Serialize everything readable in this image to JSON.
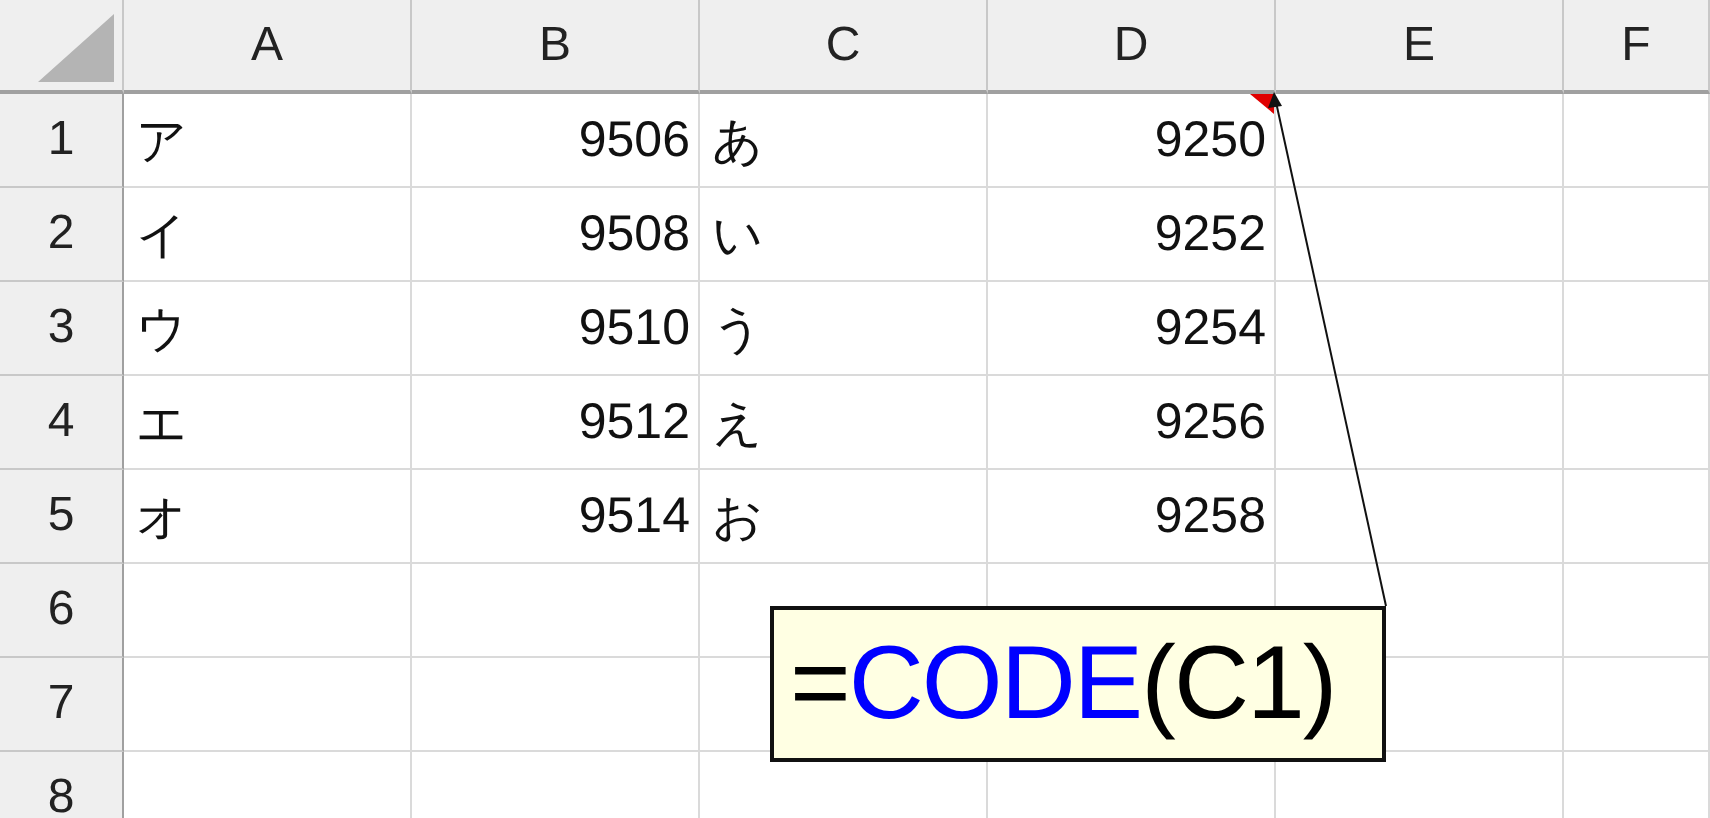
{
  "columns": [
    "A",
    "B",
    "C",
    "D",
    "E",
    "F"
  ],
  "rows": [
    {
      "header": "1",
      "cells": [
        {
          "text": "ア",
          "kind": "text"
        },
        {
          "text": "9506",
          "kind": "number"
        },
        {
          "text": "あ",
          "kind": "text"
        },
        {
          "text": "9250",
          "kind": "number"
        }
      ]
    },
    {
      "header": "2",
      "cells": [
        {
          "text": "イ",
          "kind": "text"
        },
        {
          "text": "9508",
          "kind": "number"
        },
        {
          "text": "い",
          "kind": "text"
        },
        {
          "text": "9252",
          "kind": "number"
        }
      ]
    },
    {
      "header": "3",
      "cells": [
        {
          "text": "ウ",
          "kind": "text"
        },
        {
          "text": "9510",
          "kind": "number"
        },
        {
          "text": "う",
          "kind": "text"
        },
        {
          "text": "9254",
          "kind": "number"
        }
      ]
    },
    {
      "header": "4",
      "cells": [
        {
          "text": "エ",
          "kind": "text"
        },
        {
          "text": "9512",
          "kind": "number"
        },
        {
          "text": "え",
          "kind": "text"
        },
        {
          "text": "9256",
          "kind": "number"
        }
      ]
    },
    {
      "header": "5",
      "cells": [
        {
          "text": "オ",
          "kind": "text"
        },
        {
          "text": "9514",
          "kind": "number"
        },
        {
          "text": "お",
          "kind": "text"
        },
        {
          "text": "9258",
          "kind": "number"
        }
      ]
    },
    {
      "header": "6",
      "cells": []
    },
    {
      "header": "7",
      "cells": []
    },
    {
      "header": "8",
      "cells": []
    }
  ],
  "comment": {
    "parts": [
      {
        "text": "=",
        "color": "#000000"
      },
      {
        "text": "CODE",
        "color": "#0000ff"
      },
      {
        "text": "(C1)",
        "color": "#000000"
      }
    ]
  }
}
